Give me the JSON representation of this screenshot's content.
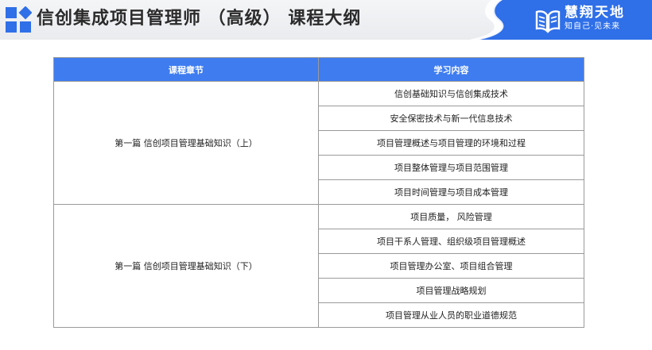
{
  "header": {
    "title": "信创集成项目管理师 （高级） 课程大纲",
    "logo_icon": "grid-logo-icon",
    "brand": {
      "name": "慧翔天地",
      "slogan": "知自己·见未来",
      "icon": "book-wing-icon",
      "color": "#2f6fe8"
    }
  },
  "table": {
    "headers": [
      "课程章节",
      "学习内容"
    ],
    "header_color": "#3e7cf0",
    "sections": [
      {
        "chapter": "第一篇 信创项目管理基础知识（上）",
        "items": [
          "信创基础知识与信创集成技术",
          "安全保密技术与新一代信息技术",
          "项目管理概述与项目管理的环境和过程",
          "项目整体管理与项目范围管理",
          "项目时间管理与项目成本管理"
        ]
      },
      {
        "chapter": "第一篇 信创项目管理基础知识（下）",
        "items": [
          "项目质量， 风险管理",
          "项目干系人管理、组织级项目管理概述",
          "项目管理办公室、项目组合管理",
          "项目管理战略规划",
          "项目管理从业人员的职业道德规范"
        ]
      }
    ]
  }
}
